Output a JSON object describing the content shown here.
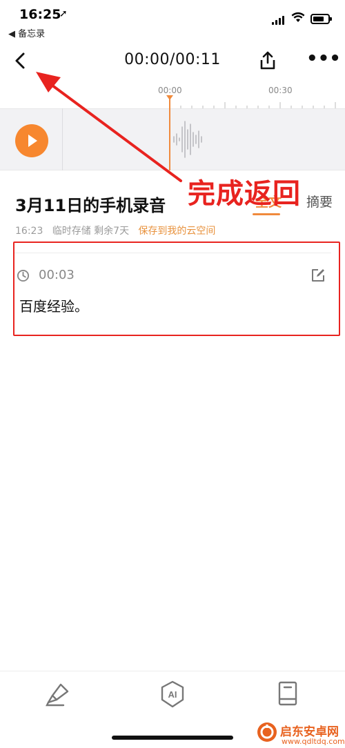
{
  "status_bar": {
    "time": "16:25",
    "location_glyph": "➚",
    "back_app": "◀ 备忘录"
  },
  "nav": {
    "back_icon": "chevron-left-icon",
    "time_display": "00:00/00:11",
    "share_icon": "share-icon",
    "more_label": "•••"
  },
  "timeline": {
    "tick_labels": [
      "00:00",
      "00:30"
    ]
  },
  "recording": {
    "title": "3月11日的手机录音",
    "tabs": [
      {
        "label": "全文",
        "active": true
      },
      {
        "label": "摘要",
        "active": false
      }
    ],
    "meta_time": "16:23",
    "meta_status": "临时存储 剩余7天",
    "save_link": "保存到我的云空间"
  },
  "transcript": {
    "segments": [
      {
        "time": "00:03",
        "text": "百度经验。"
      }
    ]
  },
  "annotation": {
    "label": "完成返回",
    "color": "#e8231f"
  },
  "toolbar": {
    "items": [
      "highlighter-icon",
      "ai-icon",
      "notebook-icon"
    ],
    "ai_label": "AI"
  },
  "watermark": {
    "title": "启东安卓网",
    "url": "www.qdltdq.com"
  },
  "colors": {
    "accent": "#f08a3c",
    "play": "#f7872f",
    "annotation": "#e8231f"
  }
}
